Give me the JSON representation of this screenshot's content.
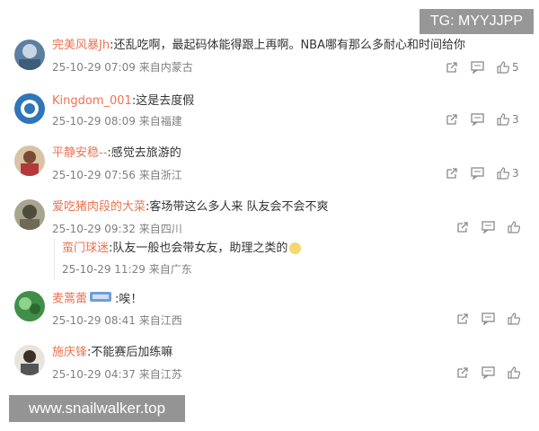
{
  "watermarks": {
    "top": "TG: MYYJJPP",
    "bottom": "www.snailwalker.top"
  },
  "colors": {
    "username": "#eb7350",
    "meta": "#808080",
    "text": "#333333"
  },
  "comments": [
    {
      "user": "完美风暴Jh",
      "text": ":还乱吃啊，最起码体能得跟上再啊。NBA哪有那么多耐心和时间给你",
      "time": "25-10-29 07:09",
      "source": "来自内蒙古",
      "likes": "5",
      "icons": [
        "share-icon",
        "comment-icon",
        "like-icon"
      ]
    },
    {
      "user": "Kingdom_001",
      "text": ":这是去度假",
      "time": "25-10-29 08:09",
      "source": "来自福建",
      "likes": "3"
    },
    {
      "user": "平静安稳--",
      "text": ":感觉去旅游的",
      "time": "25-10-29 07:56",
      "source": "来自浙江",
      "likes": "3"
    },
    {
      "user": "爱吃猪肉段的大菜",
      "text": ":客场带这么多人来 队友会不会不爽",
      "time": "25-10-29 09:32",
      "source": "来自四川",
      "likes": "",
      "reply": {
        "user": "蛮门球迷",
        "text": ":队友一般也会带女友，助理之类的",
        "time": "25-10-29 11:29",
        "source": "来自广东"
      }
    },
    {
      "user": "麦蒿蕾",
      "text": ":唉！",
      "time": "25-10-29 08:41",
      "source": "来自江西",
      "likes": ""
    },
    {
      "user": "施庆锋",
      "text": ":不能赛后加练嘛",
      "time": "25-10-29 04:37",
      "source": "来自江苏",
      "likes": ""
    }
  ]
}
